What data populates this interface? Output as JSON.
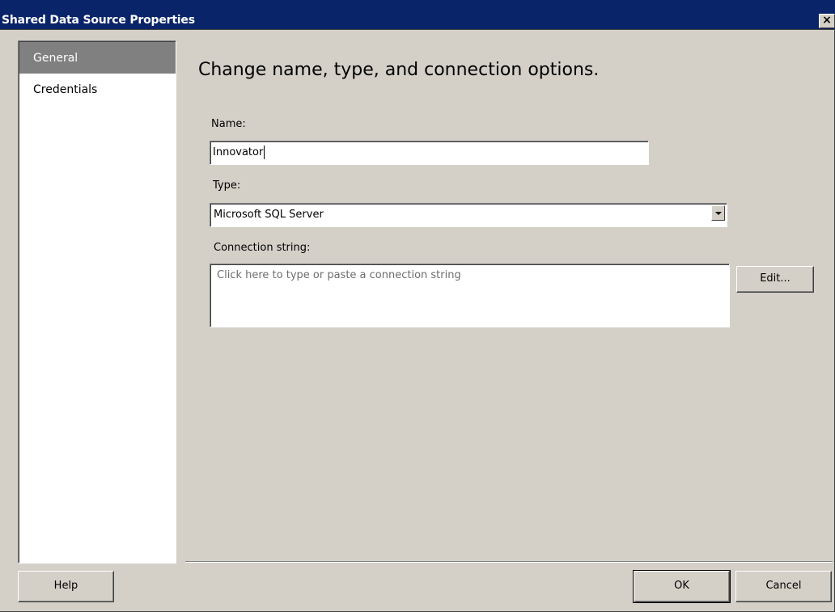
{
  "window": {
    "title": "Shared Data Source Properties",
    "close_glyph": "×"
  },
  "nav": {
    "items": [
      {
        "label": "General",
        "selected": true
      },
      {
        "label": "Credentials",
        "selected": false
      }
    ]
  },
  "main": {
    "heading": "Change name, type, and connection options.",
    "name_label": "Name:",
    "name_value": "Innovator",
    "type_label": "Type:",
    "type_value": "Microsoft SQL Server",
    "conn_label": "Connection string:",
    "conn_placeholder": "Click here to type or paste a connection string",
    "edit_label": "Edit..."
  },
  "footer": {
    "help_label": "Help",
    "ok_label": "OK",
    "cancel_label": "Cancel"
  },
  "colors": {
    "titlebar": "#0a246a",
    "face": "#d4d0c8",
    "selected_nav": "#808080"
  },
  "icons": {
    "close": "close-icon",
    "dropdown": "chevron-down-icon"
  }
}
